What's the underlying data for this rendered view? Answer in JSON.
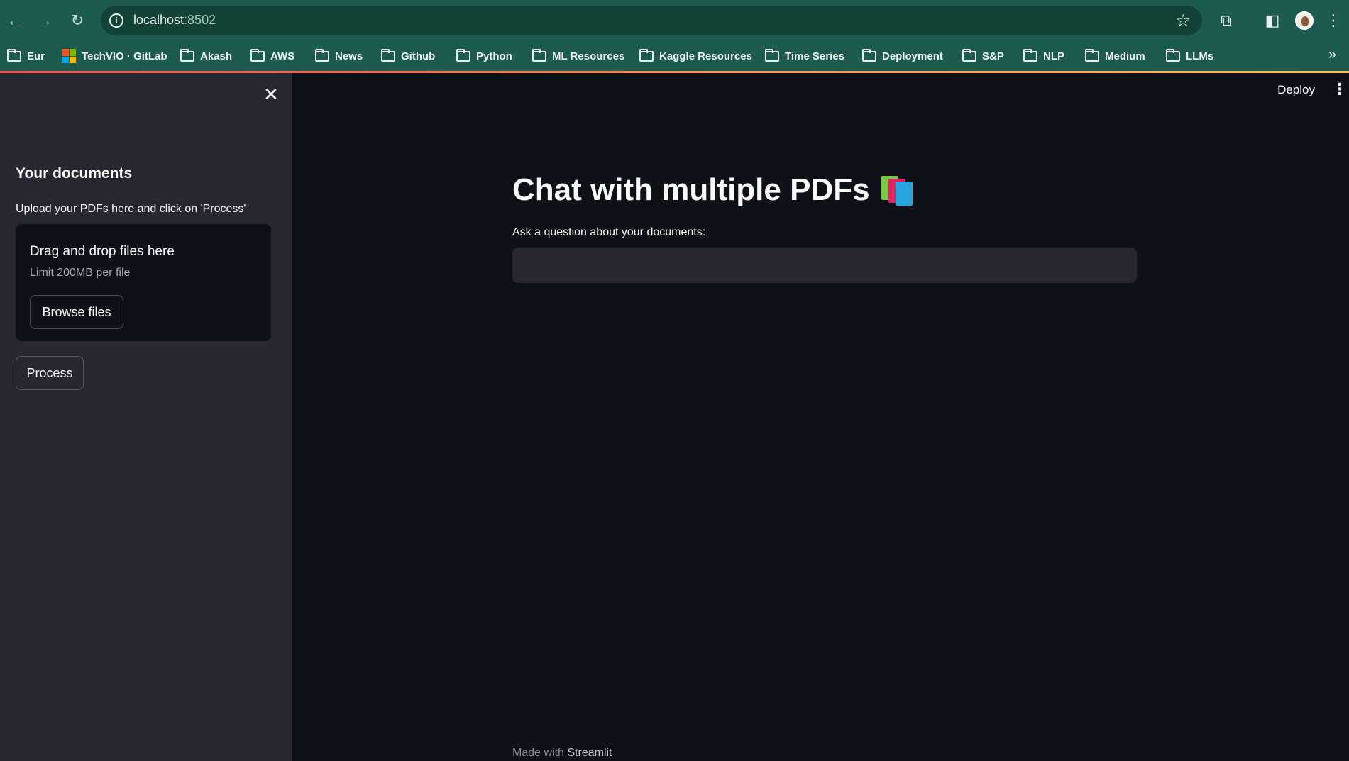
{
  "browser": {
    "url_host": "localhost",
    "url_port": ":8502",
    "bookmarks": [
      {
        "label": "Eur",
        "icon": "folder-icon"
      },
      {
        "label": "TechVIO · GitLab",
        "icon": "microsoft-logo-icon"
      },
      {
        "label": "Akash",
        "icon": "folder-icon"
      },
      {
        "label": "AWS",
        "icon": "folder-icon"
      },
      {
        "label": "News",
        "icon": "folder-icon"
      },
      {
        "label": "Github",
        "icon": "folder-icon"
      },
      {
        "label": "Python",
        "icon": "folder-icon"
      },
      {
        "label": "ML Resources",
        "icon": "folder-icon"
      },
      {
        "label": "Kaggle Resources",
        "icon": "folder-icon"
      },
      {
        "label": "Time Series",
        "icon": "folder-icon"
      },
      {
        "label": "Deployment",
        "icon": "folder-icon"
      },
      {
        "label": "S&P",
        "icon": "folder-icon"
      },
      {
        "label": "NLP",
        "icon": "folder-icon"
      },
      {
        "label": "Medium",
        "icon": "folder-icon"
      },
      {
        "label": "LLMs",
        "icon": "folder-icon"
      }
    ]
  },
  "sidebar": {
    "title": "Your documents",
    "upload_label": "Upload your PDFs here and click on 'Process'",
    "dropzone_title": "Drag and drop files here",
    "dropzone_limit": "Limit 200MB per file",
    "browse_label": "Browse files",
    "process_label": "Process"
  },
  "header": {
    "deploy_label": "Deploy"
  },
  "main": {
    "title": "Chat with multiple PDFs",
    "question_label": "Ask a question about your documents:",
    "question_value": ""
  },
  "footer": {
    "made_with": "Made with",
    "brand": "Streamlit"
  },
  "colors": {
    "browser_chrome": "#1d5a4f",
    "sidebar_bg": "#262730",
    "main_bg": "#0e1117",
    "accent_gradient_start": "#ff4b4b",
    "accent_gradient_end": "#ffbd45"
  }
}
